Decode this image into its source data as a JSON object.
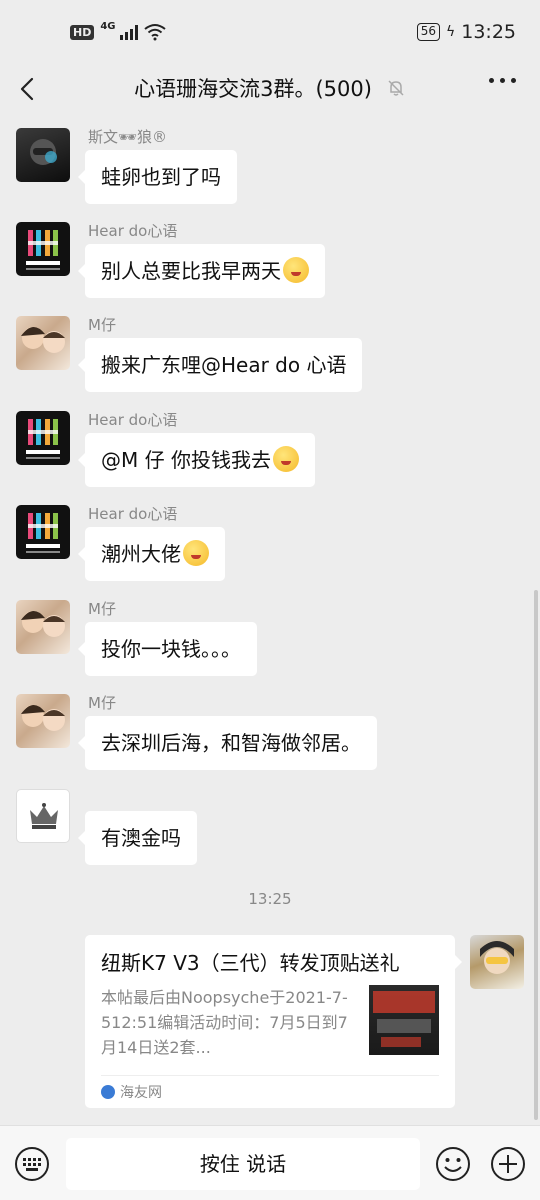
{
  "status_bar": {
    "hd": "HD",
    "network": "4G",
    "battery": "56",
    "time": "13:25"
  },
  "header": {
    "title": "心语珊海交流3群。(500)"
  },
  "messages": [
    {
      "sender": "斯文🕶狼®",
      "text": "蛙卵也到了吗",
      "emoji": false
    },
    {
      "sender": "Hear do心语",
      "text": "别人总要比我早两天",
      "emoji": true
    },
    {
      "sender": "M仔",
      "text": "搬来广东哩@Hear do 心语",
      "emoji": false
    },
    {
      "sender": "Hear do心语",
      "text": "@M 仔  你投钱我去",
      "emoji": true
    },
    {
      "sender": "Hear do心语",
      "text": "潮州大佬",
      "emoji": true
    },
    {
      "sender": "M仔",
      "text": "投你一块钱。。。",
      "emoji": false
    },
    {
      "sender": "M仔",
      "text": "去深圳后海，和智海做邻居。",
      "emoji": false
    },
    {
      "sender": "",
      "text": "有澳金吗",
      "emoji": false
    }
  ],
  "timestamp": "13:25",
  "link_card": {
    "title": "纽斯K7 V3（三代）转发顶贴送礼",
    "description": "本帖最后由Noopsyche于2021-7-512:51编辑活动时间：7月5日到7月14日送2套...",
    "source": "海友网"
  },
  "input_bar": {
    "voice_label": "按住 说话"
  },
  "icons": [
    "back-arrow-icon",
    "mute-bell-icon",
    "more-icon",
    "keyboard-icon",
    "emoji-face-icon",
    "plus-icon"
  ]
}
